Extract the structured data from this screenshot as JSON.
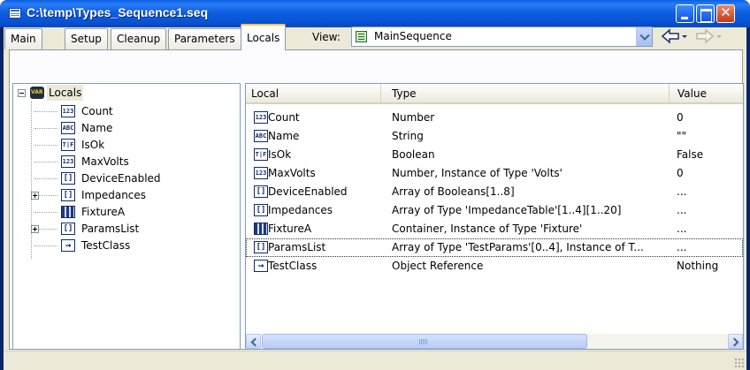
{
  "window": {
    "title": "C:\\temp\\Types_Sequence1.seq"
  },
  "tabs": [
    {
      "label": "Main"
    },
    {
      "label": "Setup"
    },
    {
      "label": "Cleanup"
    },
    {
      "label": "Parameters"
    },
    {
      "label": "Locals"
    }
  ],
  "active_tab": "Locals",
  "view": {
    "label": "View:",
    "value": "MainSequence"
  },
  "tree": {
    "root": "Locals",
    "items": [
      {
        "label": "Count",
        "icon": "number-icon"
      },
      {
        "label": "Name",
        "icon": "string-icon"
      },
      {
        "label": "IsOk",
        "icon": "boolean-icon"
      },
      {
        "label": "MaxVolts",
        "icon": "number-icon"
      },
      {
        "label": "DeviceEnabled",
        "icon": "array-icon"
      },
      {
        "label": "Impedances",
        "icon": "array-icon",
        "expandable": true
      },
      {
        "label": "FixtureA",
        "icon": "container-icon"
      },
      {
        "label": "ParamsList",
        "icon": "array-icon",
        "expandable": true
      },
      {
        "label": "TestClass",
        "icon": "object-reference-icon"
      }
    ]
  },
  "list": {
    "columns": {
      "local": "Local",
      "type": "Type",
      "value": "Value"
    },
    "rows": [
      {
        "name": "Count",
        "type": "Number",
        "value": "0"
      },
      {
        "name": "Name",
        "type": "String",
        "value": "\"\""
      },
      {
        "name": "IsOk",
        "type": "Boolean",
        "value": "False"
      },
      {
        "name": "MaxVolts",
        "type": "Number, Instance of Type 'Volts'",
        "value": "0"
      },
      {
        "name": "DeviceEnabled",
        "type": "Array of Booleans[1..8]",
        "value": "..."
      },
      {
        "name": "Impedances",
        "type": "Array of Type 'ImpedanceTable'[1..4][1..20]",
        "value": "..."
      },
      {
        "name": "FixtureA",
        "type": "Container, Instance of Type 'Fixture'",
        "value": "..."
      },
      {
        "name": "ParamsList",
        "type": "Array of Type 'TestParams'[0..4], Instance of T...",
        "value": "..."
      },
      {
        "name": "TestClass",
        "type": "Object Reference",
        "value": "Nothing"
      }
    ]
  },
  "colors": {
    "titlebar": "#0a5fe4",
    "tab_highlight": "#ffc83c",
    "face": "#ece9d8"
  }
}
